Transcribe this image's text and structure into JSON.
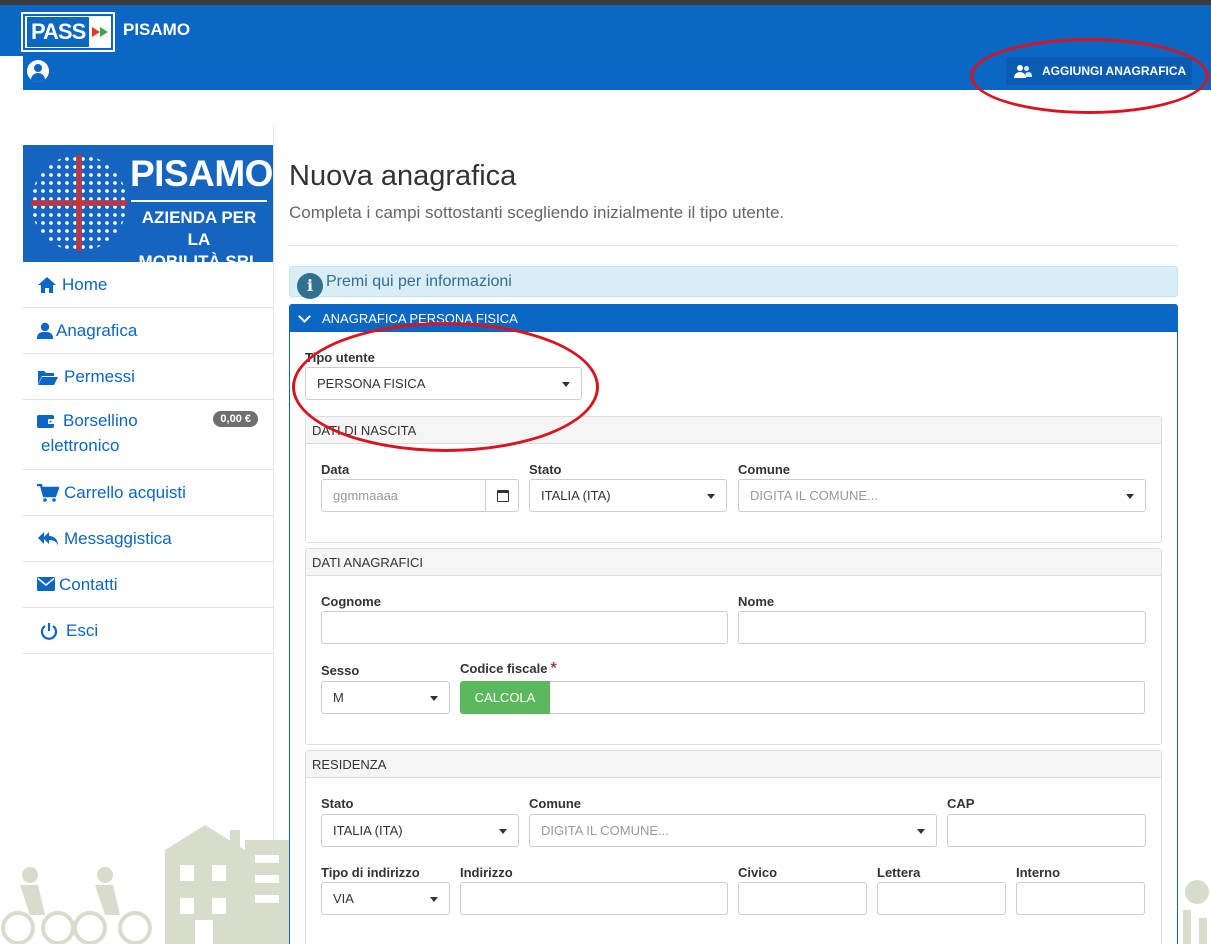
{
  "header": {
    "logo_text": "PASS",
    "brand": "PISAMO",
    "add_button_label": "AGGIUNGI ANAGRAFICA"
  },
  "sidebar": {
    "logo": {
      "title": "PISAMO",
      "subtitle_line1": "AZIENDA PER LA",
      "subtitle_line2": "MOBILITÀ SRL"
    },
    "items": [
      {
        "label": "Home",
        "icon": "home-icon"
      },
      {
        "label": "Anagrafica",
        "icon": "user-icon"
      },
      {
        "label": "Permessi",
        "icon": "folder-open-icon"
      },
      {
        "label": "Borsellino elettronico",
        "icon": "wallet-icon",
        "badge": "0,00 €"
      },
      {
        "label": "Carrello acquisti",
        "icon": "cart-icon"
      },
      {
        "label": "Messaggistica",
        "icon": "reply-all-icon"
      },
      {
        "label": "Contatti",
        "icon": "envelope-icon"
      },
      {
        "label": "Esci",
        "icon": "power-icon"
      }
    ]
  },
  "main": {
    "title": "Nuova anagrafica",
    "subtitle": "Completa i campi sottostanti scegliendo inizialmente il tipo utente.",
    "info_text": "Premi qui per informazioni",
    "panel_title": "ANAGRAFICA PERSONA FISICA",
    "tipo_utente": {
      "label": "Tipo utente",
      "value": "PERSONA FISICA"
    },
    "dati_nascita": {
      "title": "DATI DI NASCITA",
      "data_label": "Data",
      "data_placeholder": "ggmmaaaa",
      "stato_label": "Stato",
      "stato_value": "ITALIA (ITA)",
      "comune_label": "Comune",
      "comune_placeholder": "DIGITA IL COMUNE..."
    },
    "dati_anagrafici": {
      "title": "DATI ANAGRAFICI",
      "cognome_label": "Cognome",
      "nome_label": "Nome",
      "sesso_label": "Sesso",
      "sesso_value": "M",
      "codice_fiscale_label": "Codice fiscale",
      "required_mark": "*",
      "calcola_label": "CALCOLA"
    },
    "residenza": {
      "title": "RESIDENZA",
      "stato_label": "Stato",
      "stato_value": "ITALIA (ITA)",
      "comune_label": "Comune",
      "comune_placeholder": "DIGITA IL COMUNE...",
      "cap_label": "CAP",
      "tipo_indirizzo_label": "Tipo di indirizzo",
      "tipo_indirizzo_value": "VIA",
      "indirizzo_label": "Indirizzo",
      "civico_label": "Civico",
      "lettera_label": "Lettera",
      "interno_label": "Interno"
    }
  },
  "colors": {
    "primary": "#0b66c4",
    "success": "#5cb85c",
    "info_bg": "#d9edf7",
    "annotation": "#d9141f"
  }
}
